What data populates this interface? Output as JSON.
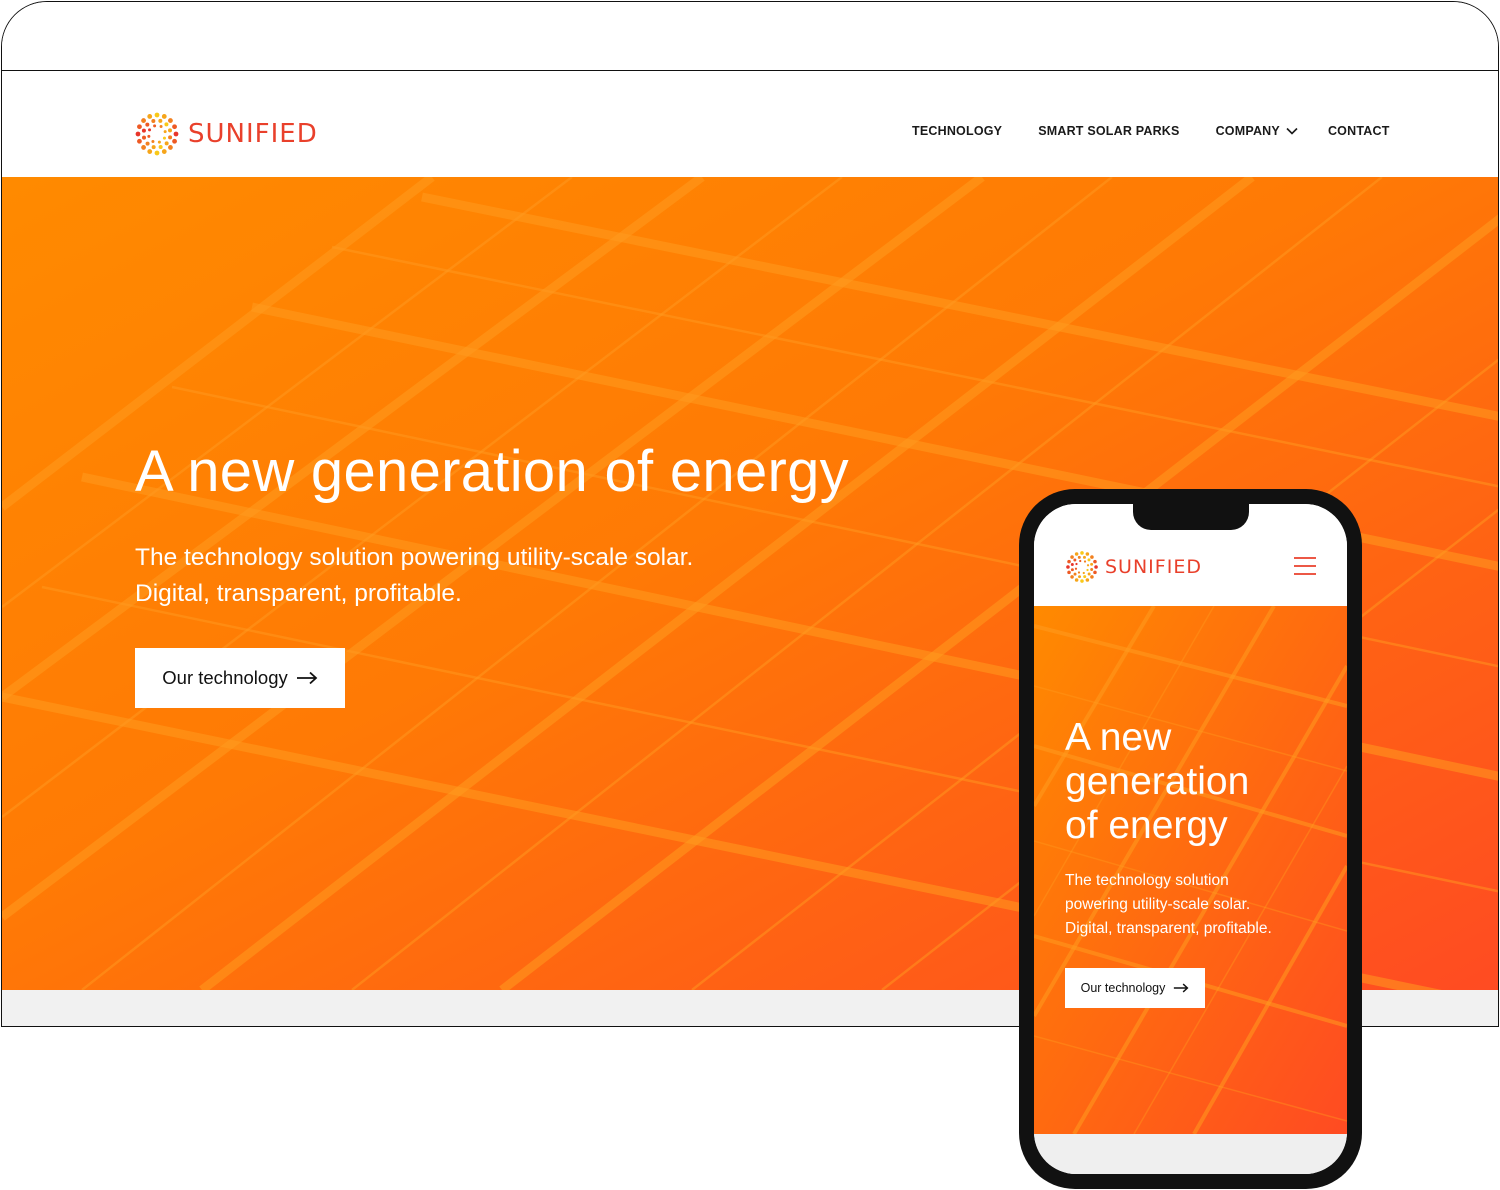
{
  "brand": {
    "name": "SUNIFIED",
    "color": "#e9402b"
  },
  "nav": {
    "items": [
      {
        "label": "TECHNOLOGY"
      },
      {
        "label": "SMART SOLAR PARKS"
      },
      {
        "label": "COMPANY",
        "icon": "chevron-down-icon"
      },
      {
        "label": "CONTACT"
      }
    ]
  },
  "hero": {
    "title": "A new generation of energy",
    "title_lines_mobile": [
      "A new",
      "generation",
      "of energy"
    ],
    "subtitle_lines": [
      "The technology solution powering utility-scale solar.",
      "Digital, transparent, profitable."
    ],
    "subtitle_lines_mobile": [
      "The technology solution",
      "powering utility-scale solar.",
      "Digital, transparent, profitable."
    ],
    "cta_label": "Our technology",
    "cta_icon": "arrow-right-icon",
    "gradient": [
      "#ff8a00",
      "#ff4b22"
    ]
  },
  "mobile": {
    "menu_icon": "hamburger-icon"
  }
}
